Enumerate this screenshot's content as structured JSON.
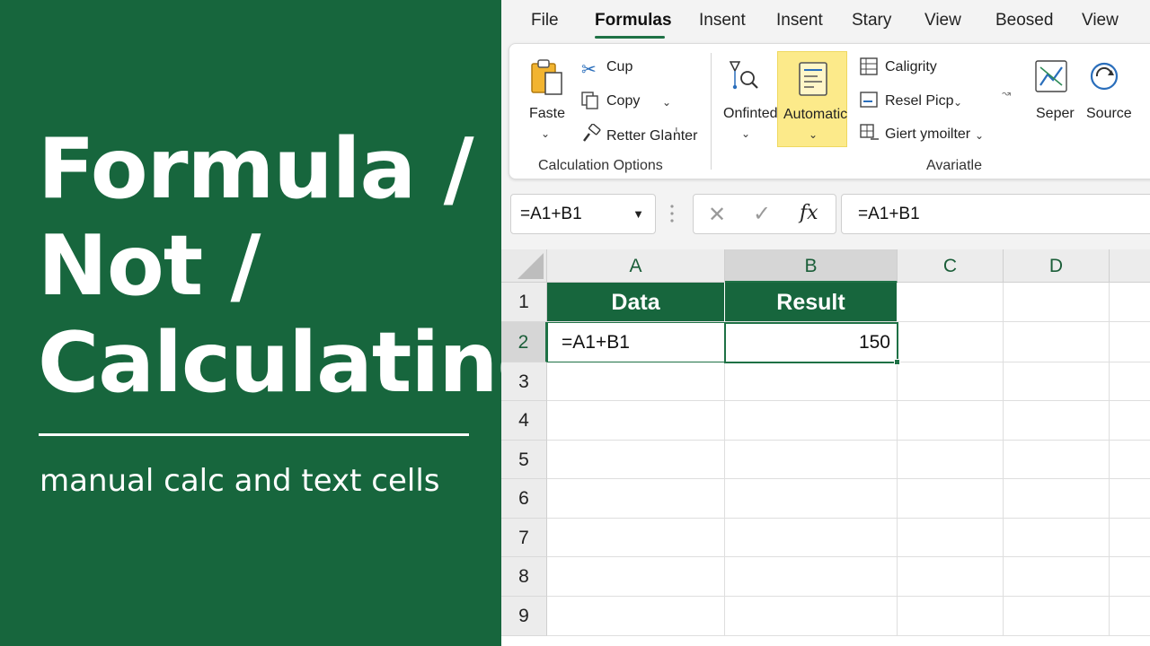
{
  "panel": {
    "title_lines": [
      "Formula /",
      "Not /",
      "Calculating"
    ],
    "subtitle": "manual calc and text cells",
    "bg_color": "#17663d"
  },
  "menu": {
    "items": [
      "File",
      "Formulas",
      "Insent",
      "Insent",
      "Stary",
      "View",
      "Beosed",
      "View"
    ],
    "active_index": 1
  },
  "ribbon": {
    "paste_label": "Faste",
    "cut_label": "Cup",
    "copy_label": "Copy",
    "format_painter_label": "Retter Glaٰnter",
    "clipboard_group_label": "Calculation Options",
    "onfinted_label": "Onfinted",
    "automatic_label": "Automatic",
    "caligrity_label": "Caligrity",
    "resel_label": "Resel Picp",
    "giert_label": "Giert ymoilter",
    "seper_label": "Seper",
    "source_label": "Source",
    "right_group_label": "Avariatle",
    "highlight_color": "#fcea8a"
  },
  "formula_bar": {
    "name_box": "=A1+B1",
    "formula": "=A1+B1"
  },
  "sheet": {
    "columns": [
      "A",
      "B",
      "C",
      "D"
    ],
    "rows": [
      "1",
      "2",
      "3",
      "4",
      "5",
      "6",
      "7",
      "8",
      "9"
    ],
    "header_a": "Data",
    "header_b": "Result",
    "a2": "=A1+B1",
    "b2": "150",
    "accent": "#1e7145"
  }
}
